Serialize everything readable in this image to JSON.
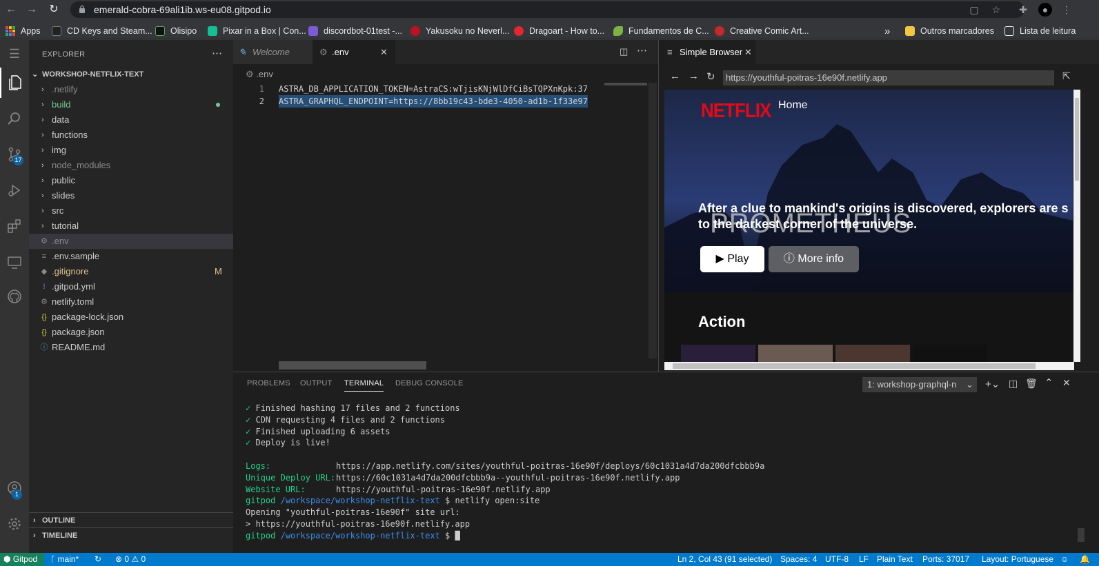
{
  "browser": {
    "url": "emerald-cobra-69ali1ib.ws-eu08.gitpod.io",
    "bookmarks": [
      {
        "label": "Apps",
        "color": "#ea4335"
      },
      {
        "label": "CD Keys and Steam...",
        "color": "#222222"
      },
      {
        "label": "Olisipo",
        "color": "#111111"
      },
      {
        "label": "Pixar in a Box | Con...",
        "color": "#14bf96"
      },
      {
        "label": "discordbot-01test -...",
        "color": "#7b5cd6"
      },
      {
        "label": "Yakusoku no Neverl...",
        "color": "#c0111f"
      },
      {
        "label": "Dragoart - How to...",
        "color": "#e3262f"
      },
      {
        "label": "Fundamentos de C...",
        "color": "#7cb342"
      },
      {
        "label": "Creative Comic Art...",
        "color": "#c62828"
      }
    ],
    "more_bookmarks": "»",
    "other_bookmarks": "Outros marcadores",
    "reading_list": "Lista de leitura"
  },
  "explorer": {
    "title": "EXPLORER",
    "root": "WORKSHOP-NETFLIX-TEXT",
    "items": [
      {
        "label": ".netlify",
        "type": "folder",
        "color": "#8b8b8b"
      },
      {
        "label": "build",
        "type": "folder",
        "color": "#73c991"
      },
      {
        "label": "data",
        "type": "folder",
        "color": "#cccccc"
      },
      {
        "label": "functions",
        "type": "folder",
        "color": "#cccccc"
      },
      {
        "label": "img",
        "type": "folder",
        "color": "#cccccc"
      },
      {
        "label": "node_modules",
        "type": "folder",
        "color": "#8b8b8b"
      },
      {
        "label": "public",
        "type": "folder",
        "color": "#cccccc"
      },
      {
        "label": "slides",
        "type": "folder",
        "color": "#cccccc"
      },
      {
        "label": "src",
        "type": "folder",
        "color": "#cccccc"
      },
      {
        "label": "tutorial",
        "type": "folder",
        "color": "#cccccc"
      },
      {
        "label": ".env",
        "type": "file",
        "color": "#8b8b8b",
        "icon": "⚙"
      },
      {
        "label": ".env.sample",
        "type": "file",
        "color": "#cccccc",
        "icon": "≡"
      },
      {
        "label": ".gitignore",
        "type": "file",
        "color": "#e2c08d",
        "icon": "◆",
        "badge": "M"
      },
      {
        "label": ".gitpod.yml",
        "type": "file",
        "color": "#cccccc",
        "icon": "!"
      },
      {
        "label": "netlify.toml",
        "type": "file",
        "color": "#cccccc",
        "icon": "⚙"
      },
      {
        "label": "package-lock.json",
        "type": "file",
        "color": "#cccccc",
        "icon": "{}"
      },
      {
        "label": "package.json",
        "type": "file",
        "color": "#cccccc",
        "icon": "{}"
      },
      {
        "label": "README.md",
        "type": "file",
        "color": "#cccccc",
        "icon": "ⓘ"
      }
    ],
    "outline": "OUTLINE",
    "timeline": "TIMELINE"
  },
  "activity": {
    "scm_badge": "17",
    "account_badge": "1"
  },
  "editor": {
    "tabs": [
      {
        "label": "Welcome"
      },
      {
        "label": ".env"
      }
    ],
    "breadcrumb": ".env",
    "lines": [
      {
        "num": "1",
        "text": "ASTRA_DB_APPLICATION_TOKEN=AstraCS:wTjisKNjWlDfCiBsTQPXnKpk:37"
      },
      {
        "num": "2",
        "text": "ASTRA_GRAPHQL_ENDPOINT=https://8bb19c43-bde3-4050-ad1b-1f33e97"
      }
    ]
  },
  "simple_browser": {
    "tab": "Simple Browser",
    "url": "https://youthful-poitras-16e90f.netlify.app",
    "logo": "NETFLIX",
    "nav_home": "Home",
    "hero_title": "PROMETHEUS",
    "hero_desc_1": "After a clue to mankind's origins is discovered, explorers are s",
    "hero_desc_2": "to the darkest corner of the universe.",
    "play": "Play",
    "more_info": "More info",
    "section": "Action"
  },
  "panel": {
    "tabs": [
      "PROBLEMS",
      "OUTPUT",
      "TERMINAL",
      "DEBUG CONSOLE"
    ],
    "active_tab": "TERMINAL",
    "terminal_select": "1: workshop-graphql-n",
    "lines": [
      {
        "prefix": "✓",
        "text": "Finished hashing 17 files and 2 functions"
      },
      {
        "prefix": "✓",
        "text": "CDN requesting 4 files and 2 functions"
      },
      {
        "prefix": "✓",
        "text": "Finished uploading 6 assets"
      },
      {
        "prefix": "✓",
        "text": "Deploy is live!"
      }
    ],
    "kv": [
      {
        "key": "Logs:",
        "value": "https://app.netlify.com/sites/youthful-poitras-16e90f/deploys/60c1031a4d7da200dfcbbb9a"
      },
      {
        "key": "Unique Deploy URL:",
        "value": "https://60c1031a4d7da200dfcbbb9a--youthful-poitras-16e90f.netlify.app"
      },
      {
        "key": "Website URL:",
        "value": "https://youthful-poitras-16e90f.netlify.app"
      }
    ],
    "prompt_user": "gitpod",
    "prompt_path": "/workspace/workshop-netflix-text",
    "command": "$ netlify open:site",
    "opening": "Opening \"youthful-poitras-16e90f\" site url:",
    "opened_url": "> https://youthful-poitras-16e90f.netlify.app",
    "final_prompt": "$"
  },
  "status": {
    "remote": "Gitpod",
    "branch": "main*",
    "problems": "⊗ 0 ⚠ 0",
    "cursor": "Ln 2, Col 43 (91 selected)",
    "spaces": "Spaces: 4",
    "encoding": "UTF-8",
    "eol": "LF",
    "language": "Plain Text",
    "ports": "Ports: 37017",
    "layout": "Layout: Portuguese"
  },
  "colors": {
    "accent": "#007acc",
    "netflix_red": "#e50914",
    "added": "#73c991",
    "modified": "#e2c08d"
  }
}
